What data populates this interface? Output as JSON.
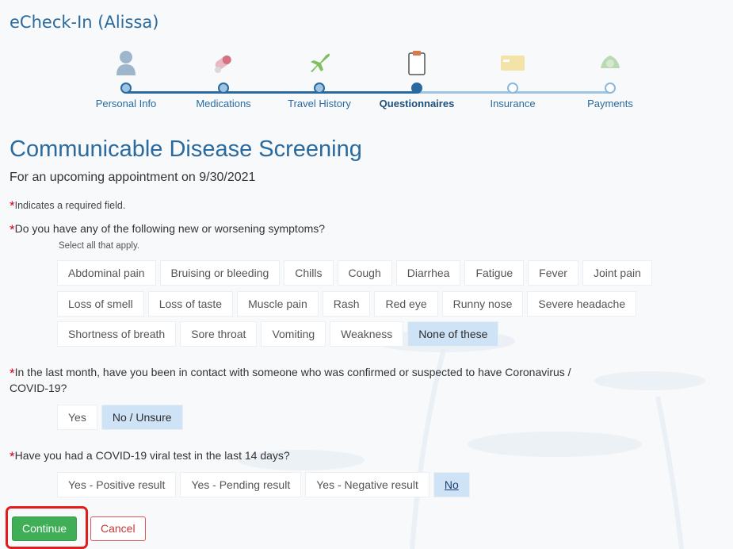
{
  "app": {
    "title": "eCheck-In (Alissa)"
  },
  "stepper": {
    "steps": [
      {
        "label": "Personal Info",
        "icon": "person-icon",
        "state": "done"
      },
      {
        "label": "Medications",
        "icon": "pills-icon",
        "state": "done"
      },
      {
        "label": "Travel History",
        "icon": "airplane-icon",
        "state": "done"
      },
      {
        "label": "Questionnaires",
        "icon": "clipboard-icon",
        "state": "current"
      },
      {
        "label": "Insurance",
        "icon": "card-icon",
        "state": "todo"
      },
      {
        "label": "Payments",
        "icon": "money-icon",
        "state": "todo"
      }
    ]
  },
  "page": {
    "title": "Communicable Disease Screening",
    "subtitle": "For an upcoming appointment on 9/30/2021",
    "required_note": "Indicates a required field.",
    "required_mark": "*"
  },
  "q1": {
    "text": "Do you have any of the following new or worsening symptoms?",
    "hint": "Select all that apply.",
    "rows": [
      [
        "Abdominal pain",
        "Bruising or bleeding",
        "Chills",
        "Cough",
        "Diarrhea",
        "Fatigue",
        "Fever",
        "Joint pain"
      ],
      [
        "Loss of smell",
        "Loss of taste",
        "Muscle pain",
        "Rash",
        "Red eye",
        "Runny nose",
        "Severe headache"
      ],
      [
        "Shortness of breath",
        "Sore throat",
        "Vomiting",
        "Weakness",
        "None of these"
      ]
    ],
    "selected": "None of these"
  },
  "q2": {
    "text_line1": "In the last month, have you been in contact with someone who was confirmed or suspected to have Coronavirus /",
    "text_line2": "COVID-19?",
    "options": [
      "Yes",
      "No / Unsure"
    ],
    "selected": "No / Unsure"
  },
  "q3": {
    "text": "Have you had a COVID-19 viral test in the last 14 days?",
    "options": [
      "Yes - Positive result",
      "Yes - Pending result",
      "Yes - Negative result",
      "No"
    ],
    "selected": "No"
  },
  "actions": {
    "continue_label": "Continue",
    "cancel_label": "Cancel"
  },
  "colors": {
    "brand": "#2a6a9e",
    "continue": "#3fae56",
    "cancel": "#c43838",
    "selected_chip": "#cfe3f6",
    "highlight": "#e41b1b"
  }
}
